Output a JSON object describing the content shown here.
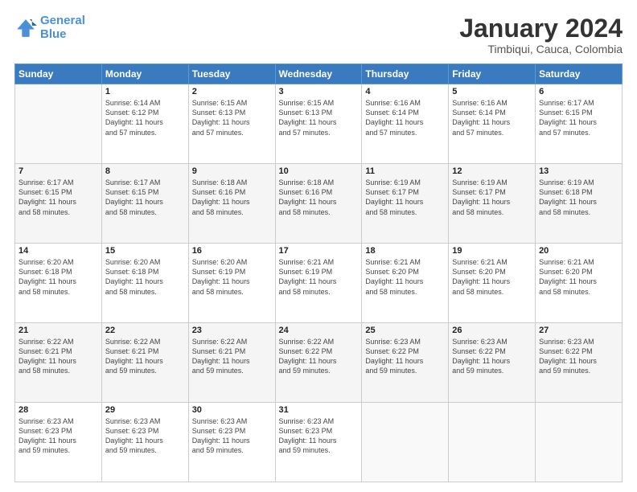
{
  "header": {
    "logo_line1": "General",
    "logo_line2": "Blue",
    "title": "January 2024",
    "subtitle": "Timbiqui, Cauca, Colombia"
  },
  "weekdays": [
    "Sunday",
    "Monday",
    "Tuesday",
    "Wednesday",
    "Thursday",
    "Friday",
    "Saturday"
  ],
  "weeks": [
    [
      {
        "day": "",
        "info": ""
      },
      {
        "day": "1",
        "info": "Sunrise: 6:14 AM\nSunset: 6:12 PM\nDaylight: 11 hours\nand 57 minutes."
      },
      {
        "day": "2",
        "info": "Sunrise: 6:15 AM\nSunset: 6:13 PM\nDaylight: 11 hours\nand 57 minutes."
      },
      {
        "day": "3",
        "info": "Sunrise: 6:15 AM\nSunset: 6:13 PM\nDaylight: 11 hours\nand 57 minutes."
      },
      {
        "day": "4",
        "info": "Sunrise: 6:16 AM\nSunset: 6:14 PM\nDaylight: 11 hours\nand 57 minutes."
      },
      {
        "day": "5",
        "info": "Sunrise: 6:16 AM\nSunset: 6:14 PM\nDaylight: 11 hours\nand 57 minutes."
      },
      {
        "day": "6",
        "info": "Sunrise: 6:17 AM\nSunset: 6:15 PM\nDaylight: 11 hours\nand 57 minutes."
      }
    ],
    [
      {
        "day": "7",
        "info": "Sunrise: 6:17 AM\nSunset: 6:15 PM\nDaylight: 11 hours\nand 58 minutes."
      },
      {
        "day": "8",
        "info": "Sunrise: 6:17 AM\nSunset: 6:15 PM\nDaylight: 11 hours\nand 58 minutes."
      },
      {
        "day": "9",
        "info": "Sunrise: 6:18 AM\nSunset: 6:16 PM\nDaylight: 11 hours\nand 58 minutes."
      },
      {
        "day": "10",
        "info": "Sunrise: 6:18 AM\nSunset: 6:16 PM\nDaylight: 11 hours\nand 58 minutes."
      },
      {
        "day": "11",
        "info": "Sunrise: 6:19 AM\nSunset: 6:17 PM\nDaylight: 11 hours\nand 58 minutes."
      },
      {
        "day": "12",
        "info": "Sunrise: 6:19 AM\nSunset: 6:17 PM\nDaylight: 11 hours\nand 58 minutes."
      },
      {
        "day": "13",
        "info": "Sunrise: 6:19 AM\nSunset: 6:18 PM\nDaylight: 11 hours\nand 58 minutes."
      }
    ],
    [
      {
        "day": "14",
        "info": "Sunrise: 6:20 AM\nSunset: 6:18 PM\nDaylight: 11 hours\nand 58 minutes."
      },
      {
        "day": "15",
        "info": "Sunrise: 6:20 AM\nSunset: 6:18 PM\nDaylight: 11 hours\nand 58 minutes."
      },
      {
        "day": "16",
        "info": "Sunrise: 6:20 AM\nSunset: 6:19 PM\nDaylight: 11 hours\nand 58 minutes."
      },
      {
        "day": "17",
        "info": "Sunrise: 6:21 AM\nSunset: 6:19 PM\nDaylight: 11 hours\nand 58 minutes."
      },
      {
        "day": "18",
        "info": "Sunrise: 6:21 AM\nSunset: 6:20 PM\nDaylight: 11 hours\nand 58 minutes."
      },
      {
        "day": "19",
        "info": "Sunrise: 6:21 AM\nSunset: 6:20 PM\nDaylight: 11 hours\nand 58 minutes."
      },
      {
        "day": "20",
        "info": "Sunrise: 6:21 AM\nSunset: 6:20 PM\nDaylight: 11 hours\nand 58 minutes."
      }
    ],
    [
      {
        "day": "21",
        "info": "Sunrise: 6:22 AM\nSunset: 6:21 PM\nDaylight: 11 hours\nand 58 minutes."
      },
      {
        "day": "22",
        "info": "Sunrise: 6:22 AM\nSunset: 6:21 PM\nDaylight: 11 hours\nand 59 minutes."
      },
      {
        "day": "23",
        "info": "Sunrise: 6:22 AM\nSunset: 6:21 PM\nDaylight: 11 hours\nand 59 minutes."
      },
      {
        "day": "24",
        "info": "Sunrise: 6:22 AM\nSunset: 6:22 PM\nDaylight: 11 hours\nand 59 minutes."
      },
      {
        "day": "25",
        "info": "Sunrise: 6:23 AM\nSunset: 6:22 PM\nDaylight: 11 hours\nand 59 minutes."
      },
      {
        "day": "26",
        "info": "Sunrise: 6:23 AM\nSunset: 6:22 PM\nDaylight: 11 hours\nand 59 minutes."
      },
      {
        "day": "27",
        "info": "Sunrise: 6:23 AM\nSunset: 6:22 PM\nDaylight: 11 hours\nand 59 minutes."
      }
    ],
    [
      {
        "day": "28",
        "info": "Sunrise: 6:23 AM\nSunset: 6:23 PM\nDaylight: 11 hours\nand 59 minutes."
      },
      {
        "day": "29",
        "info": "Sunrise: 6:23 AM\nSunset: 6:23 PM\nDaylight: 11 hours\nand 59 minutes."
      },
      {
        "day": "30",
        "info": "Sunrise: 6:23 AM\nSunset: 6:23 PM\nDaylight: 11 hours\nand 59 minutes."
      },
      {
        "day": "31",
        "info": "Sunrise: 6:23 AM\nSunset: 6:23 PM\nDaylight: 11 hours\nand 59 minutes."
      },
      {
        "day": "",
        "info": ""
      },
      {
        "day": "",
        "info": ""
      },
      {
        "day": "",
        "info": ""
      }
    ]
  ]
}
